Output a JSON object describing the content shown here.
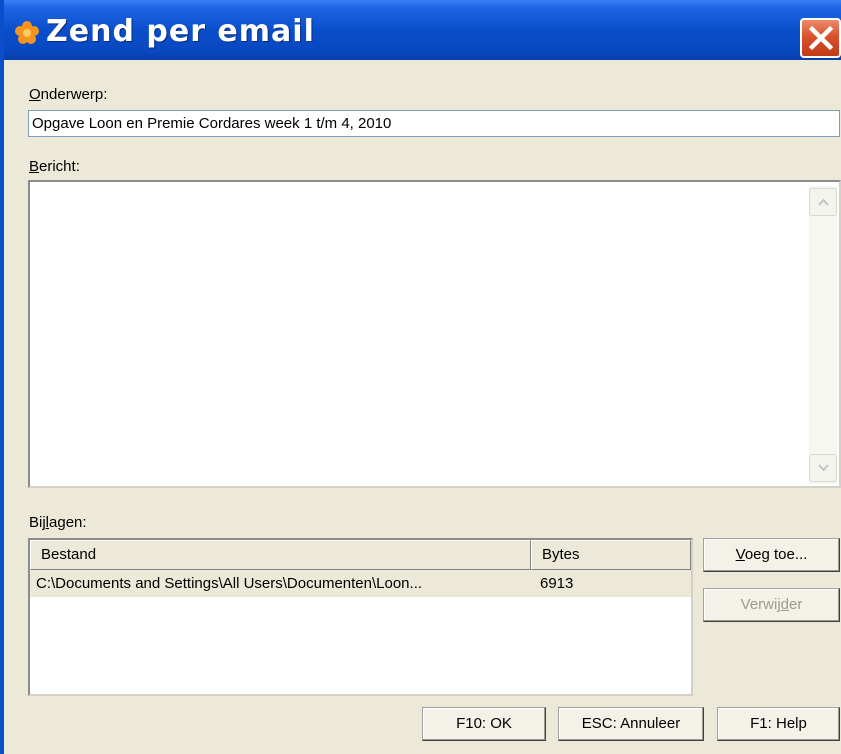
{
  "window": {
    "title": "Zend per email"
  },
  "subject": {
    "label_accel": "O",
    "label_rest": "nderwerp:",
    "value": "Opgave Loon en Premie Cordares week 1 t/m 4, 2010"
  },
  "message": {
    "label_accel": "B",
    "label_rest": "ericht:",
    "value": ""
  },
  "attachments": {
    "label_pre": "Bij",
    "label_accel": "l",
    "label_post": "agen:",
    "columns": {
      "file": "Bestand",
      "bytes": "Bytes"
    },
    "rows": [
      {
        "file": "C:\\Documents and Settings\\All Users\\Documenten\\Loon...",
        "bytes": "6913"
      }
    ]
  },
  "buttons": {
    "add_accel": "V",
    "add_rest": "oeg toe...",
    "remove_pre": "Verwij",
    "remove_accel": "d",
    "remove_post": "er",
    "ok": "F10: OK",
    "cancel": "ESC: Annuleer",
    "help": "F1: Help"
  },
  "colors": {
    "title_bar": "#0a4ecb",
    "close_button": "#d8522e",
    "dialog_bg": "#ece9d8",
    "disabled_text": "#9c9a92"
  },
  "icons": [
    "app-flower-icon",
    "close-icon",
    "scroll-up-arrow-icon",
    "scroll-down-arrow-icon"
  ]
}
